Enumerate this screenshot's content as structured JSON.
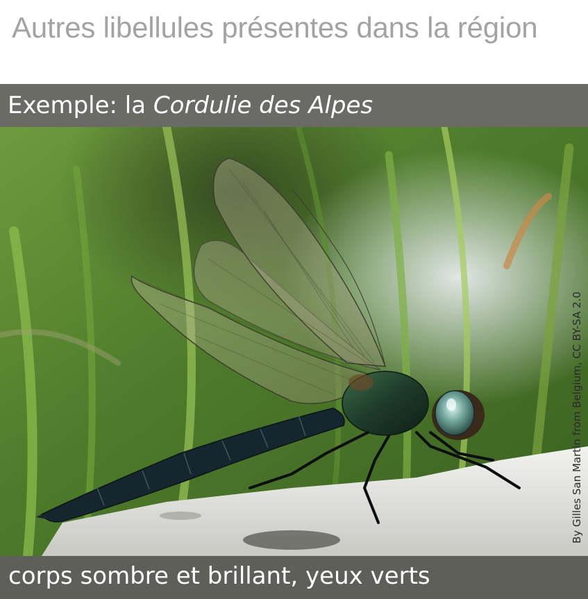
{
  "heading": "Autres libellules présentes dans la région",
  "example": {
    "prefix": "Exemple: la ",
    "species": "Cordulie des Alpes"
  },
  "photo": {
    "credit": "By Gilles San Martin from Belgium, CC BY-SA 2.0"
  },
  "caption": "corps sombre et brillant, yeux verts"
}
